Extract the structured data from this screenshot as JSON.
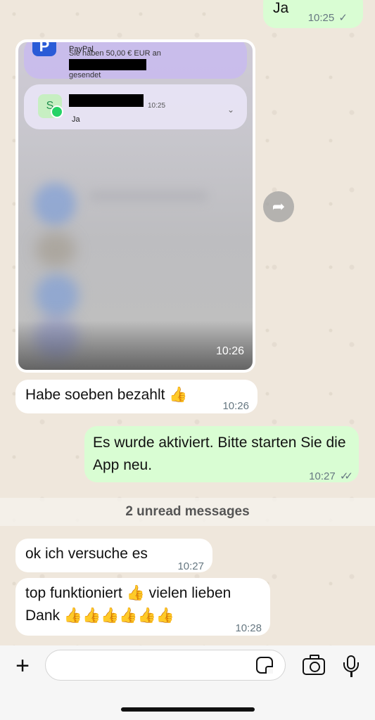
{
  "messages": {
    "ja": {
      "text": "Ja",
      "time": "10:25",
      "status": "✓"
    },
    "image": {
      "time": "10:26",
      "paypal": {
        "title": "PayPal",
        "body_before": "Sie haben 50,00 € EUR an",
        "body_after": "gesendet"
      },
      "whatsapp_notif": {
        "avatar_letter": "S",
        "time": "10:25",
        "message": "Ja"
      }
    },
    "paid": {
      "text": "Habe soeben bezahlt 👍",
      "time": "10:26"
    },
    "activated": {
      "text": "Es wurde aktiviert. Bitte starten Sie die App neu.",
      "time": "10:27",
      "status": "✓✓"
    },
    "unread": "2 unread messages",
    "try": {
      "text": "ok ich versuche es",
      "time": "10:27"
    },
    "top": {
      "text": "top funktioniert 👍 vielen lieben Dank 👍👍👍👍👍👍",
      "time": "10:28"
    }
  },
  "compose": {
    "value": "",
    "placeholder": ""
  },
  "icons": {
    "plus": "plus-icon",
    "sticker": "sticker-icon",
    "camera": "camera-icon",
    "mic": "microphone-icon",
    "forward": "forward-icon"
  },
  "colors": {
    "incoming": "#ffffff",
    "outgoing": "#d9fdd3",
    "wallpaper": "#efe7dc"
  }
}
